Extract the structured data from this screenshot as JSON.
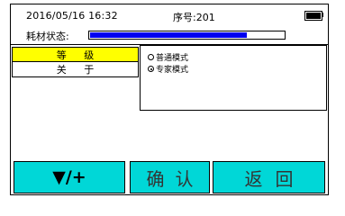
{
  "status": {
    "datetime": "2016/05/16 16:32",
    "serial": "序号:201",
    "consumable_label": "耗材状态:",
    "consumable_level": 0.81,
    "battery_icon": "battery-full-icon"
  },
  "menu": {
    "items": [
      {
        "label": "等 级",
        "selected": true
      },
      {
        "label": "关 于",
        "selected": false
      }
    ]
  },
  "options": [
    {
      "label": "普通模式",
      "checked": false
    },
    {
      "label": "专家模式",
      "checked": true
    }
  ],
  "softkeys": {
    "k1": "▼/+",
    "k2": "确认",
    "k3": "返回"
  },
  "colors": {
    "highlight": "#ffff00",
    "softkey": "#00d7d7",
    "progress": "#0000f0"
  }
}
